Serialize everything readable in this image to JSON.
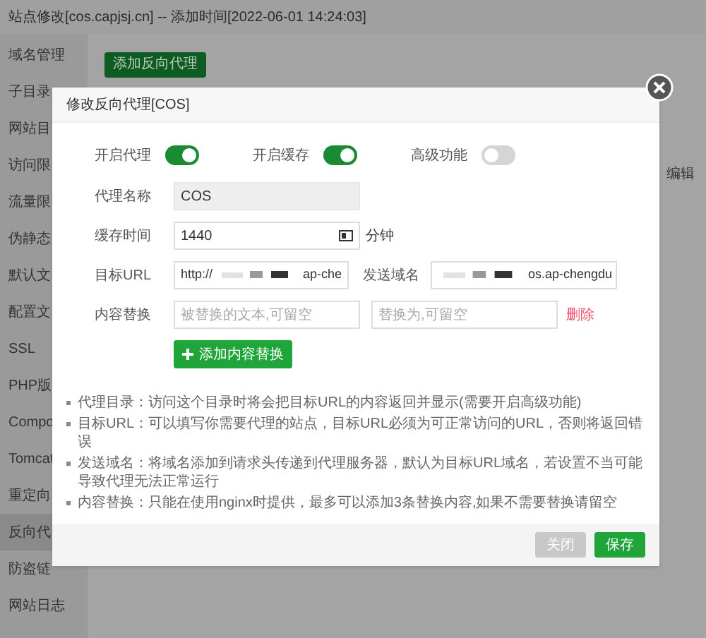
{
  "window": {
    "title": "站点修改[cos.capjsj.cn] -- 添加时间[2022-06-01 14:24:03]"
  },
  "sidebar": {
    "items": [
      {
        "label": "域名管理",
        "selected": false
      },
      {
        "label": "子目录",
        "selected": false
      },
      {
        "label": "网站目",
        "selected": false
      },
      {
        "label": "访问限",
        "selected": false
      },
      {
        "label": "流量限",
        "selected": false
      },
      {
        "label": "伪静态",
        "selected": false
      },
      {
        "label": "默认文",
        "selected": false
      },
      {
        "label": "配置文",
        "selected": false
      },
      {
        "label": "SSL",
        "selected": false
      },
      {
        "label": "PHP版",
        "selected": false
      },
      {
        "label": "Compo",
        "selected": false
      },
      {
        "label": "Tomcat",
        "selected": false
      },
      {
        "label": "重定向",
        "selected": false
      },
      {
        "label": "反向代",
        "selected": true
      },
      {
        "label": "防盗链",
        "selected": false
      },
      {
        "label": "网站日志",
        "selected": false
      }
    ]
  },
  "toolbar": {
    "add_button": "添加反向代理"
  },
  "background_link": "编辑",
  "dialog": {
    "title": "修改反向代理[COS]",
    "toggles": [
      {
        "label": "开启代理",
        "on": true
      },
      {
        "label": "开启缓存",
        "on": true
      },
      {
        "label": "高级功能",
        "on": false
      }
    ],
    "proxy_name": {
      "label": "代理名称",
      "value": "COS",
      "disabled": true
    },
    "cache_time": {
      "label": "缓存时间",
      "value": "1440",
      "unit": "分钟"
    },
    "target_url": {
      "label": "目标URL",
      "value_start": "http://",
      "value_end": "ap-che"
    },
    "send_domain": {
      "label": "发送域名",
      "value_end": "os.ap-chengdu"
    },
    "content_replace": {
      "label": "内容替换",
      "placeholder_from": "被替换的文本,可留空",
      "placeholder_to": "替换为,可留空",
      "delete": "删除"
    },
    "add_replace_button": "添加内容替换",
    "notes": [
      "代理目录：访问这个目录时将会把目标URL的内容返回并显示(需要开启高级功能)",
      "目标URL：可以填写你需要代理的站点，目标URL必须为可正常访问的URL，否则将返回错误",
      "发送域名：将域名添加到请求头传递到代理服务器，默认为目标URL域名，若设置不当可能导致代理无法正常运行",
      "内容替换：只能在使用nginx时提供，最多可以添加3条替换内容,如果不需要替换请留空"
    ],
    "buttons": [
      {
        "label": "关闭",
        "kind": "secondary"
      },
      {
        "label": "保存",
        "kind": "primary"
      }
    ]
  }
}
